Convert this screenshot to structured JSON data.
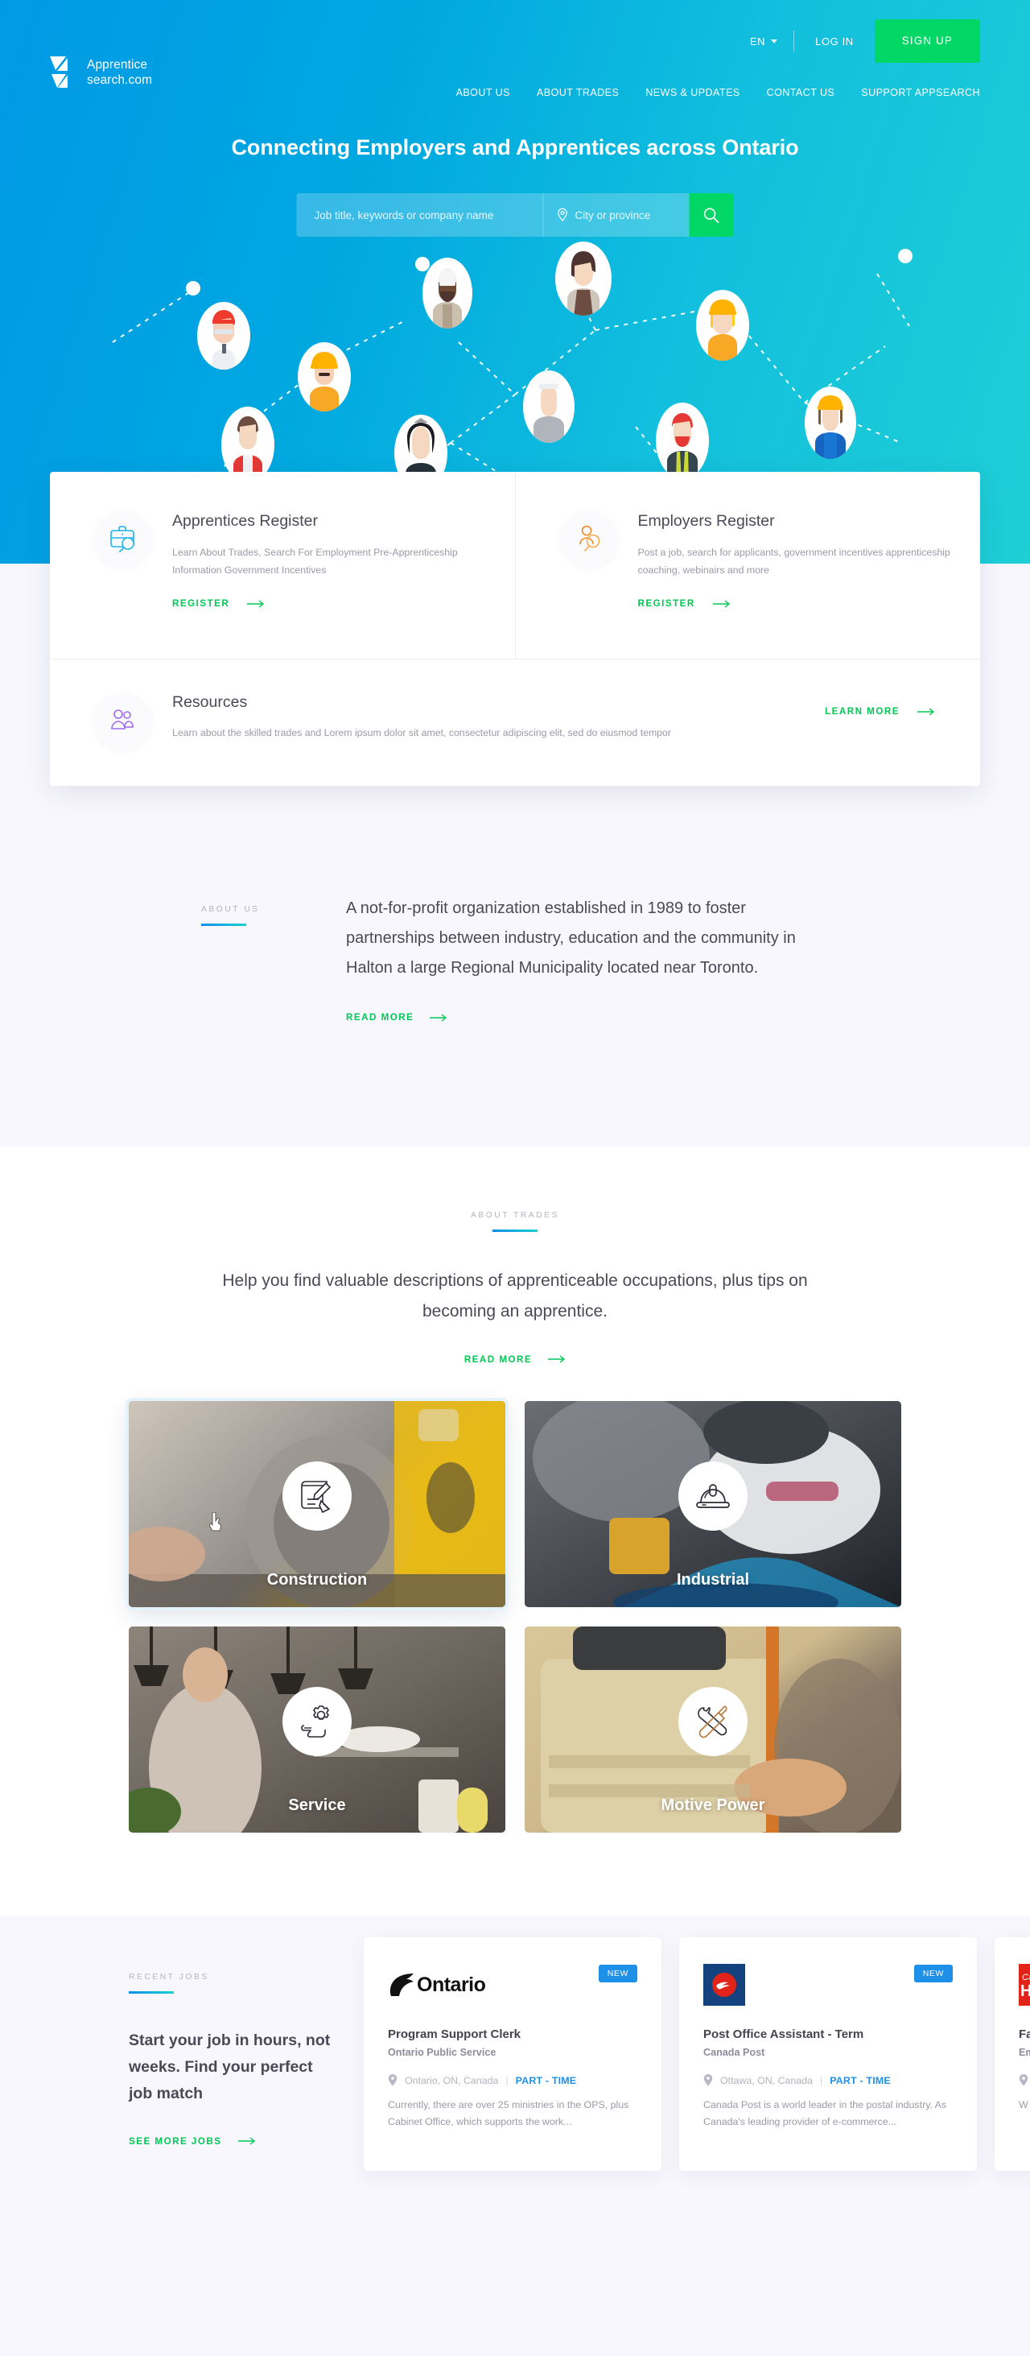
{
  "header": {
    "logo_line1": "Apprentice",
    "logo_line2": "search.com",
    "lang": "EN",
    "login": "LOG IN",
    "signup": "SIGN UP",
    "nav": [
      {
        "label": "ABOUT US"
      },
      {
        "label": "ABOUT TRADES"
      },
      {
        "label": "NEWS & UPDATES"
      },
      {
        "label": "CONTACT US"
      },
      {
        "label": "SUPPORT APPSEARCH"
      }
    ]
  },
  "hero": {
    "title": "Connecting Employers and Apprentices across Ontario",
    "search": {
      "keyword_placeholder": "Job title, keywords or company name",
      "keyword_value": "",
      "location_placeholder": "City or province",
      "location_value": "",
      "button_icon": "search-icon"
    },
    "accent_green": "#00d765",
    "gradient_from": "#0099e5",
    "gradient_to": "#1ecfd6"
  },
  "panel": {
    "apprentices": {
      "icon": "briefcase-search-icon",
      "title": "Apprentices Register",
      "desc": "Learn About Trades, Search For Employment Pre-Apprenticeship Information Government Incentives",
      "link": "REGISTER"
    },
    "employers": {
      "icon": "people-search-icon",
      "title": "Employers Register",
      "desc": "Post a job, search for applicants, government incentives apprenticeship coaching, webinairs and more",
      "link": "REGISTER"
    },
    "resources": {
      "icon": "users-icon",
      "title": "Resources",
      "desc": "Learn about the skilled trades and Lorem ipsum dolor sit amet, consectetur adipiscing elit, sed do eiusmod tempor",
      "link": "LEARN MORE"
    }
  },
  "about": {
    "eyebrow": "ABOUT US",
    "body": "A not-for-profit organization established in 1989 to foster partnerships between industry, education and the community in Halton a large Regional Municipality located near Toronto.",
    "link": "READ MORE"
  },
  "trades": {
    "eyebrow": "ABOUT TRADES",
    "lead": "Help you find valuable descriptions of apprenticeable occupations, plus tips on becoming an apprentice.",
    "link": "READ MORE",
    "cards": [
      {
        "label": "Construction",
        "icon": "blueprint-pencil-icon",
        "selected": true
      },
      {
        "label": "Industrial",
        "icon": "hard-hat-icon",
        "selected": false
      },
      {
        "label": "Service",
        "icon": "gear-hand-icon",
        "selected": false
      },
      {
        "label": "Motive Power",
        "icon": "wrench-screwdriver-icon",
        "selected": false
      }
    ]
  },
  "jobs": {
    "eyebrow": "RECENT JOBS",
    "heading": "Start your job in hours, not weeks. Find your perfect job match",
    "link": "SEE MORE JOBS",
    "badge_new": "NEW",
    "items": [
      {
        "logo": "ontario-logo",
        "logo_text": "Ontario",
        "badge": "NEW",
        "title": "Program Support Clerk",
        "company": "Ontario Public Service",
        "location": "Ontario, ON, Canada",
        "type": "PART - TIME",
        "desc": "Currently, there are over 25 ministries in the OPS, plus Cabinet Office, which supports the work..."
      },
      {
        "logo": "canada-post-logo",
        "logo_text": "",
        "badge": "NEW",
        "title": "Post Office Assistant - Term",
        "company": "Canada Post",
        "location": "Ottawa, ON, Canada",
        "type": "PART - TIME",
        "desc": "Canada Post is a world leader in the postal industry. As Canada's leading provider of e-commerce..."
      },
      {
        "logo": "canadian-help-logo",
        "logo_text": "",
        "badge": "",
        "title": "Fa",
        "company": "Em",
        "location": "",
        "type": "",
        "desc": "W str"
      }
    ]
  }
}
